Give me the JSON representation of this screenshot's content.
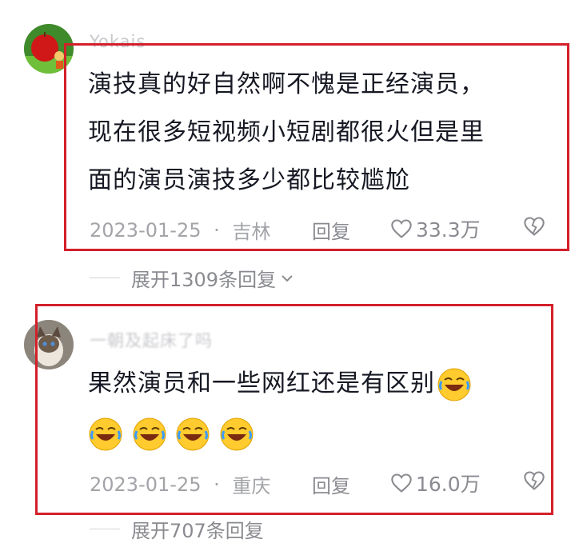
{
  "comments": [
    {
      "username": "Yokais",
      "text_lines": [
        "演技真的好自然啊不愧是正经演员，",
        "现在很多短视频小短剧都很火但是里",
        "面的演员演技多少都比较尴尬"
      ],
      "date": "2023-01-25",
      "location": "吉林",
      "reply_label": "回复",
      "likes": "33.3万",
      "expand_label": "展开1309条回复"
    },
    {
      "username": "一朝及起床了吗",
      "text_lines": [
        "果然演员和一些网红还是有区别"
      ],
      "date": "2023-01-25",
      "location": "重庆",
      "reply_label": "回复",
      "likes": "16.0万",
      "expand_label": "展开707条回复"
    }
  ],
  "separator": "·",
  "colors": {
    "highlight_border": "#d3202a",
    "meta_text": "#a3a4a8",
    "body_text": "#161823"
  },
  "icons": [
    "heart-icon",
    "dislike-heart-icon",
    "chevron-down-icon",
    "laughing-crying-emoji"
  ]
}
